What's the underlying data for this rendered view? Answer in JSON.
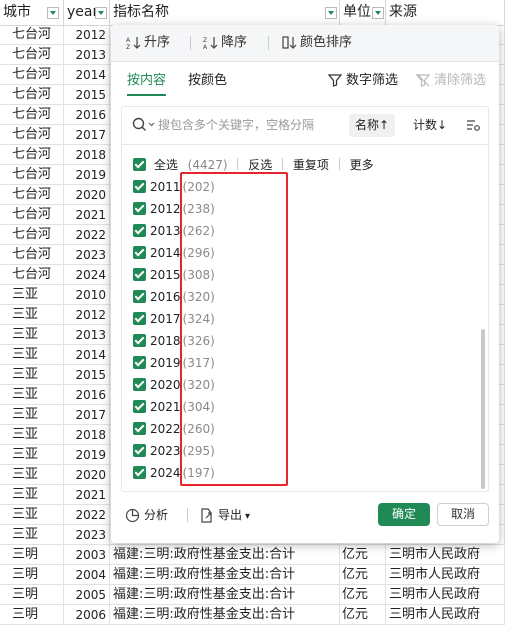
{
  "sheet": {
    "headers": {
      "city": "城市",
      "year": "year",
      "name": "指标名称",
      "unit": "单位",
      "source": "来源"
    },
    "rows": [
      {
        "city": "七台河",
        "year": "2012",
        "name": "",
        "unit": "",
        "source": ""
      },
      {
        "city": "七台河",
        "year": "2013",
        "name": "",
        "unit": "",
        "source": ""
      },
      {
        "city": "七台河",
        "year": "2014",
        "name": "",
        "unit": "",
        "source": ""
      },
      {
        "city": "七台河",
        "year": "2015",
        "name": "",
        "unit": "",
        "source": ""
      },
      {
        "city": "七台河",
        "year": "2016",
        "name": "",
        "unit": "",
        "source": ""
      },
      {
        "city": "七台河",
        "year": "2017",
        "name": "",
        "unit": "",
        "source": ""
      },
      {
        "city": "七台河",
        "year": "2018",
        "name": "",
        "unit": "",
        "source": ""
      },
      {
        "city": "七台河",
        "year": "2019",
        "name": "",
        "unit": "",
        "source": ""
      },
      {
        "city": "七台河",
        "year": "2020",
        "name": "",
        "unit": "",
        "source": ""
      },
      {
        "city": "七台河",
        "year": "2021",
        "name": "",
        "unit": "",
        "source": ""
      },
      {
        "city": "七台河",
        "year": "2022",
        "name": "",
        "unit": "",
        "source": ""
      },
      {
        "city": "七台河",
        "year": "2023",
        "name": "",
        "unit": "",
        "source": ""
      },
      {
        "city": "七台河",
        "year": "2024",
        "name": "",
        "unit": "",
        "source": ""
      },
      {
        "city": "三亚",
        "year": "2010",
        "name": "",
        "unit": "",
        "source": ""
      },
      {
        "city": "三亚",
        "year": "2012",
        "name": "",
        "unit": "",
        "source": ""
      },
      {
        "city": "三亚",
        "year": "2013",
        "name": "",
        "unit": "",
        "source": ""
      },
      {
        "city": "三亚",
        "year": "2014",
        "name": "",
        "unit": "",
        "source": ""
      },
      {
        "city": "三亚",
        "year": "2015",
        "name": "",
        "unit": "",
        "source": ""
      },
      {
        "city": "三亚",
        "year": "2016",
        "name": "",
        "unit": "",
        "source": ""
      },
      {
        "city": "三亚",
        "year": "2017",
        "name": "",
        "unit": "",
        "source": ""
      },
      {
        "city": "三亚",
        "year": "2018",
        "name": "",
        "unit": "",
        "source": ""
      },
      {
        "city": "三亚",
        "year": "2019",
        "name": "",
        "unit": "",
        "source": ""
      },
      {
        "city": "三亚",
        "year": "2020",
        "name": "",
        "unit": "",
        "source": ""
      },
      {
        "city": "三亚",
        "year": "2021",
        "name": "",
        "unit": "",
        "source": ""
      },
      {
        "city": "三亚",
        "year": "2022",
        "name": "",
        "unit": "",
        "source": ""
      },
      {
        "city": "三亚",
        "year": "2023",
        "name": "",
        "unit": "",
        "source": ""
      },
      {
        "city": "三明",
        "year": "2003",
        "name": "福建:三明:政府性基金支出:合计",
        "unit": "亿元",
        "source": "三明市人民政府"
      },
      {
        "city": "三明",
        "year": "2004",
        "name": "福建:三明:政府性基金支出:合计",
        "unit": "亿元",
        "source": "三明市人民政府"
      },
      {
        "city": "三明",
        "year": "2005",
        "name": "福建:三明:政府性基金支出:合计",
        "unit": "亿元",
        "source": "三明市人民政府"
      },
      {
        "city": "三明",
        "year": "2006",
        "name": "福建:三明:政府性基金支出:合计",
        "unit": "亿元",
        "source": "三明市人民政府"
      }
    ]
  },
  "filter": {
    "toolbar": {
      "sort_asc": "升序",
      "sort_desc": "降序",
      "color_sort": "颜色排序"
    },
    "tabs": {
      "by_content": "按内容",
      "by_color": "按颜色"
    },
    "tools": {
      "number_filter": "数字筛选",
      "clear_filter": "清除筛选"
    },
    "search": {
      "placeholder": "搜包含多个关键字，空格分隔"
    },
    "sort": {
      "by_name": "名称↑",
      "by_count": "计数↓"
    },
    "select_all": {
      "label": "全选",
      "count": "(4427)"
    },
    "actions": {
      "invert": "反选",
      "duplicates": "重复项",
      "more": "更多"
    },
    "items": [
      {
        "label": "2011",
        "count": "(202)"
      },
      {
        "label": "2012",
        "count": "(238)"
      },
      {
        "label": "2013",
        "count": "(262)"
      },
      {
        "label": "2014",
        "count": "(296)"
      },
      {
        "label": "2015",
        "count": "(308)"
      },
      {
        "label": "2016",
        "count": "(320)"
      },
      {
        "label": "2017",
        "count": "(324)"
      },
      {
        "label": "2018",
        "count": "(326)"
      },
      {
        "label": "2019",
        "count": "(317)"
      },
      {
        "label": "2020",
        "count": "(320)"
      },
      {
        "label": "2021",
        "count": "(304)"
      },
      {
        "label": "2022",
        "count": "(260)"
      },
      {
        "label": "2023",
        "count": "(295)"
      },
      {
        "label": "2024",
        "count": "(197)"
      }
    ],
    "footer": {
      "analyze": "分析",
      "export": "导出",
      "ok": "确定",
      "cancel": "取消"
    },
    "colors": {
      "accent": "#1f8a55",
      "highlight": "#e5262a"
    }
  }
}
